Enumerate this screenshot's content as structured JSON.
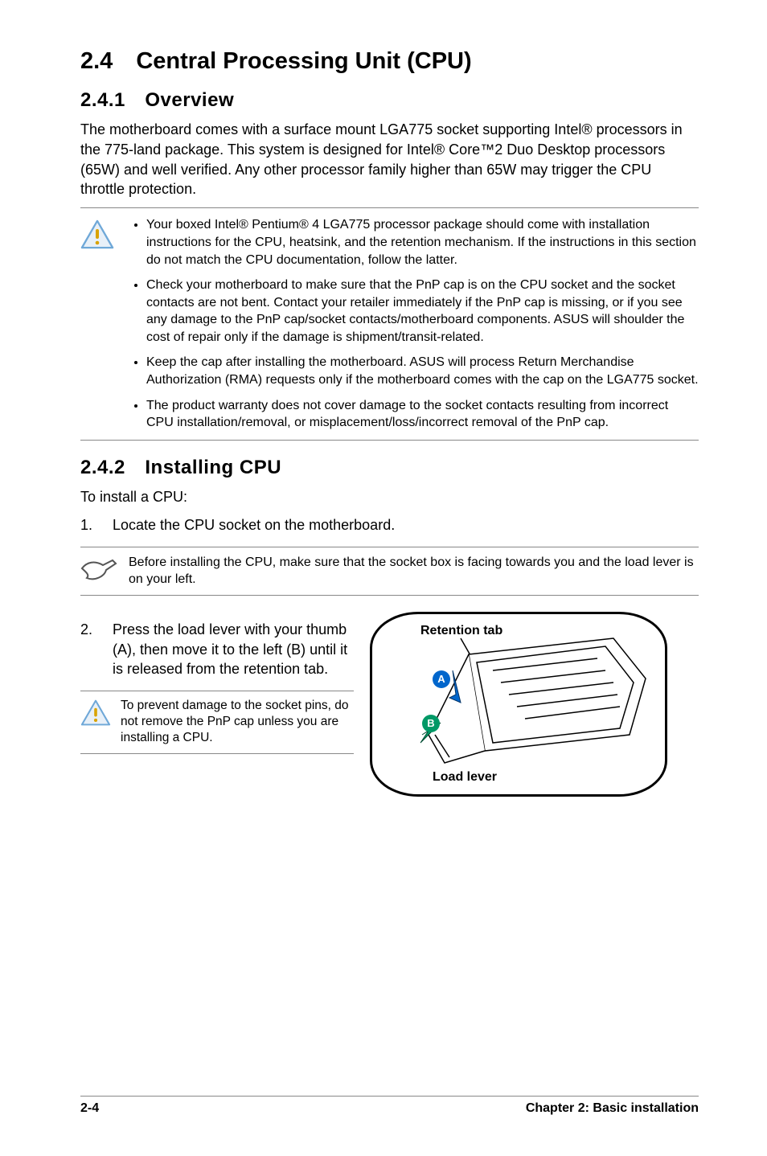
{
  "title": "2.4 Central Processing Unit (CPU)",
  "sec241": {
    "heading": "2.4.1 Overview",
    "para": "The motherboard comes with a surface mount LGA775 socket supporting Intel® processors in the 775-land package. This system is designed for Intel® Core™2 Duo Desktop processors (65W) and well verified. Any other processor family higher than 65W may trigger the CPU throttle protection."
  },
  "warn1": {
    "b1": "Your boxed Intel® Pentium® 4 LGA775 processor package should come with installation instructions for the CPU, heatsink, and the retention mechanism. If the instructions in this section do not match the CPU documentation, follow the latter.",
    "b2": "Check your motherboard to make sure that the PnP cap is on the CPU socket and the socket contacts are not bent. Contact your retailer immediately if the PnP cap is missing, or if you see any damage to the PnP cap/socket contacts/motherboard components. ASUS will shoulder the cost of repair only if the damage is shipment/transit-related.",
    "b3": "Keep the cap after installing the motherboard. ASUS will process Return Merchandise Authorization (RMA) requests only if the motherboard comes with the cap on the LGA775 socket.",
    "b4": "The product warranty does not cover damage to the socket contacts resulting from incorrect CPU installation/removal, or misplacement/loss/incorrect removal of the PnP cap."
  },
  "sec242": {
    "heading": "2.4.2 Installing CPU",
    "intro": "To install a CPU:",
    "step1_num": "1.",
    "step1": "Locate the CPU socket on the motherboard.",
    "note1": "Before installing the CPU, make sure that the socket box is facing towards you and the load lever is on your left.",
    "step2_num": "2.",
    "step2": "Press the load lever with your thumb (A), then move it to the left (B) until it is released from the retention tab.",
    "warn2": "To prevent damage to the socket pins, do not remove the PnP cap unless you are installing a CPU."
  },
  "diagram": {
    "retention": "Retention tab",
    "loadlever": "Load lever",
    "a": "A",
    "b": "B"
  },
  "footer": {
    "left": "2-4",
    "right": "Chapter 2: Basic installation"
  }
}
